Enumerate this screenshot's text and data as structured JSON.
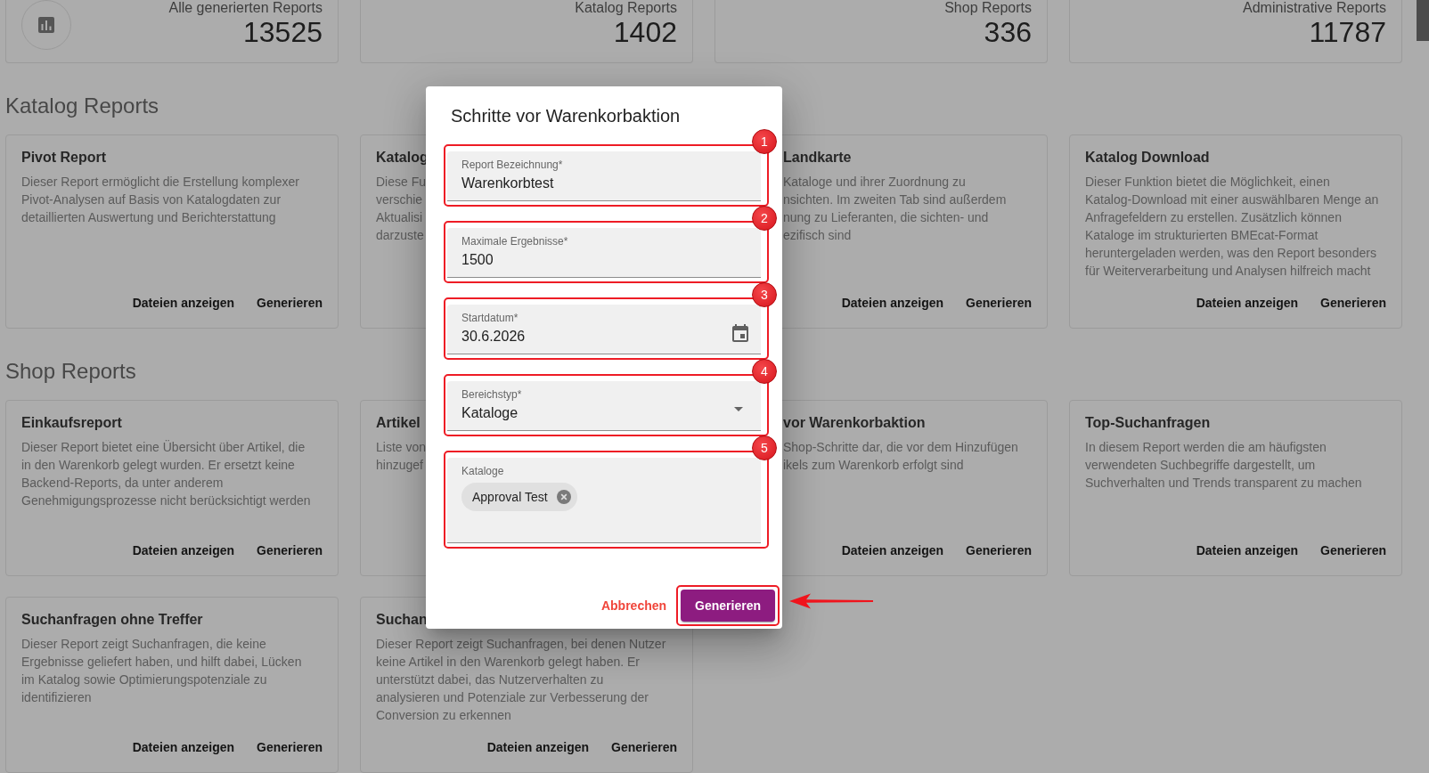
{
  "stats": [
    {
      "kind": "icon",
      "label": "Alle generierten Reports",
      "value": "13525"
    },
    {
      "kind": "plain",
      "label": "Katalog Reports",
      "value": "1402"
    },
    {
      "kind": "plain",
      "label": "Shop Reports",
      "value": "336"
    },
    {
      "kind": "plain",
      "label": "Administrative Reports",
      "value": "11787"
    }
  ],
  "sections": [
    {
      "title": "Katalog Reports",
      "cards": [
        {
          "kind": "card",
          "title": "Pivot Report",
          "description": [
            "Dieser Report ermöglicht die Erstellung komplexer",
            "Pivot-Analysen auf Basis von Katalogdaten zur",
            "detaillierten Auswertung und Berichterstattung"
          ],
          "actions": [
            "Dateien anzeigen",
            "Generieren"
          ]
        },
        {
          "kind": "card",
          "title": "Katalog",
          "description": [
            "Diese Fu",
            "verschie",
            "Aktualisi",
            "darzuste"
          ]
        },
        {
          "kind": "right_part",
          "title": "Landkarte",
          "description": [
            "Kataloge und ihrer Zuordnung zu",
            "nsichten. Im zweiten Tab sind außerdem",
            "nung zu Lieferanten, die sichten- und",
            "ezifisch sind"
          ],
          "actions": [
            "Dateien anzeigen",
            "Generieren"
          ]
        },
        {
          "kind": "card",
          "title": "Katalog Download",
          "description": [
            "Dieser Funktion bietet die Möglichkeit, einen",
            "Katalog-Download mit einer auswählbaren Menge an",
            "Anfragefeldern zu erstellen. Zusätzlich können",
            "Kataloge im strukturierten BMEcat-Format",
            "heruntergeladen werden, was den Report besonders",
            "für Weiterverarbeitung und Analysen hilfreich macht"
          ],
          "actions": [
            "Dateien anzeigen",
            "Generieren"
          ]
        }
      ]
    },
    {
      "title": "Shop Reports",
      "cards": [
        {
          "kind": "card",
          "title": "Einkaufsreport",
          "description": [
            "Dieser Report bietet eine Übersicht über Artikel, die",
            "in den Warenkorb gelegt wurden. Er ersetzt keine",
            "Backend-Reports, da unter anderem",
            "Genehmigungsprozesse nicht berücksichtigt werden"
          ],
          "actions": [
            "Dateien anzeigen",
            "Generieren"
          ]
        },
        {
          "kind": "card",
          "title": "Artikel",
          "description": [
            "Liste von",
            "hinzugef"
          ]
        },
        {
          "kind": "right_part",
          "title": "vor Warenkorbaktion",
          "description": [
            "Shop-Schritte dar, die vor dem Hinzufügen",
            "ikels zum Warenkorb erfolgt sind"
          ],
          "actions": [
            "Dateien anzeigen",
            "Generieren"
          ]
        },
        {
          "kind": "card",
          "title": "Top-Suchanfragen",
          "description": [
            "In diesem Report werden die am häufigsten",
            "verwendeten Suchbegriffe dargestellt, um",
            "Suchverhalten und Trends transparent zu machen"
          ],
          "actions": [
            "Dateien anzeigen",
            "Generieren"
          ]
        },
        {
          "kind": "card",
          "title": "Suchanfragen ohne Treffer",
          "description": [
            "Dieser Report zeigt Suchanfragen, die keine",
            "Ergebnisse geliefert haben, und hilft dabei, Lücken",
            "im Katalog sowie Optimierungspotenziale zu",
            "identifizieren"
          ],
          "actions": [
            "Dateien anzeigen",
            "Generieren"
          ]
        },
        {
          "kind": "card",
          "title": "Suchan",
          "description": [
            "Dieser Report zeigt Suchanfragen, bei denen Nutzer",
            "keine Artikel in den Warenkorb gelegt haben. Er",
            "unterstützt dabei, das Nutzerverhalten zu",
            "analysieren und Potenziale zur Verbesserung der",
            "Conversion zu erkennen"
          ],
          "actions": [
            "Dateien anzeigen",
            "Generieren"
          ]
        }
      ]
    }
  ],
  "dialog": {
    "title": "Schritte vor Warenkorbaktion",
    "fields": [
      {
        "kind": "text",
        "label": "Report Bezeichnung*",
        "value": "Warenkorbtest",
        "marker": "1"
      },
      {
        "kind": "text",
        "label": "Maximale Ergebnisse*",
        "value": "1500",
        "marker": "2"
      },
      {
        "kind": "date",
        "label": "Startdatum*",
        "value": "30.6.2026",
        "marker": "3"
      },
      {
        "kind": "select",
        "label": "Bereichstyp*",
        "value": "Kataloge",
        "marker": "4"
      },
      {
        "kind": "chips",
        "label": "Kataloge",
        "chips": [
          "Approval Test"
        ],
        "marker": "5"
      }
    ],
    "cancel": "Abbrechen",
    "submit": {
      "label": "Generieren",
      "highlighted": true
    }
  }
}
